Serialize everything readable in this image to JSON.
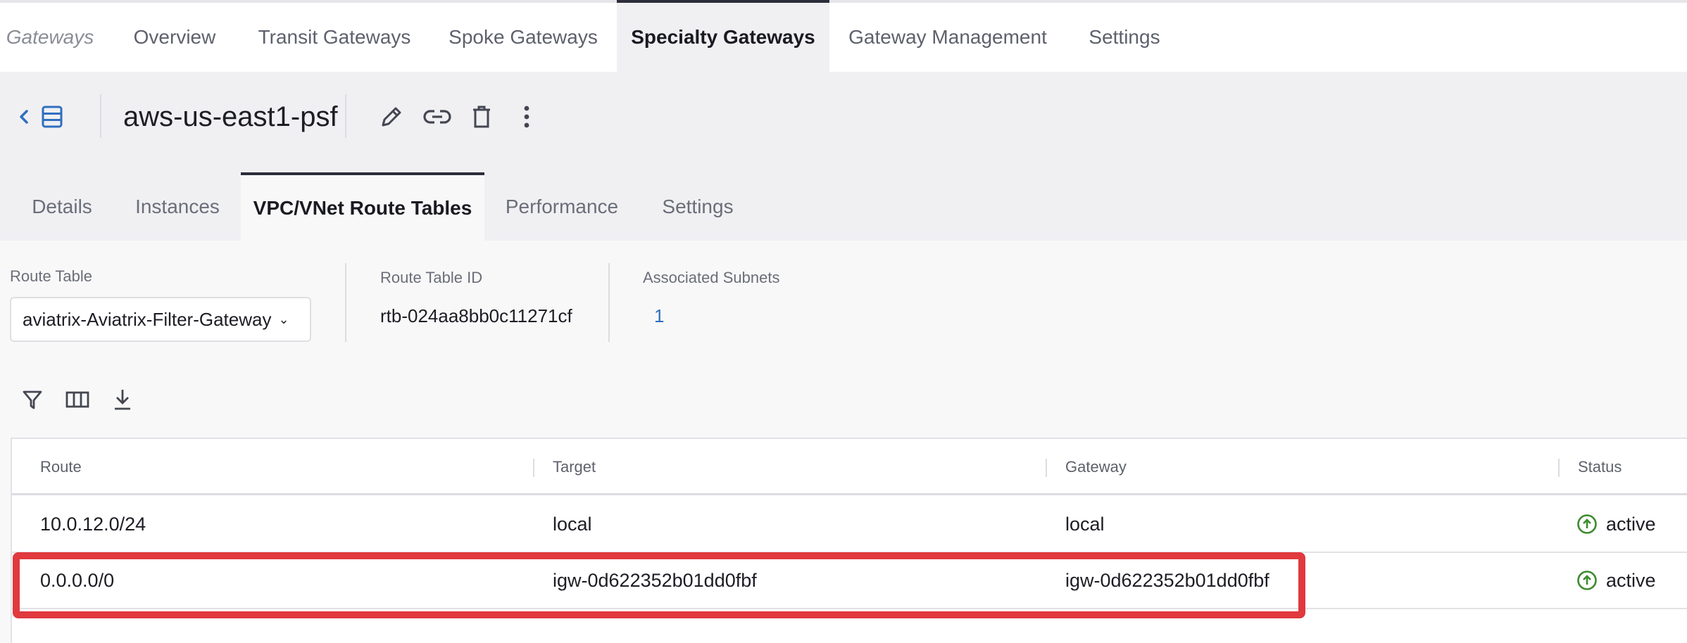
{
  "topnav": {
    "breadcrumb": "Gateways",
    "tabs": [
      "Overview",
      "Transit Gateways",
      "Spoke Gateways",
      "Specialty Gateways",
      "Gateway Management",
      "Settings"
    ],
    "active_tab": "Specialty Gateways"
  },
  "header": {
    "gateway_name": "aws-us-east1-psf",
    "icons": [
      "back-icon",
      "list-icon",
      "edit-icon",
      "link-icon",
      "delete-icon",
      "more-icon"
    ]
  },
  "subtabs": {
    "items": [
      "Details",
      "Instances",
      "VPC/VNet Route Tables",
      "Performance",
      "Settings"
    ],
    "active": "VPC/VNet Route Tables"
  },
  "route_table": {
    "label": "Route Table",
    "selected": "aviatrix-Aviatrix-Filter-Gateway",
    "id_label": "Route Table ID",
    "id_value": "rtb-024aa8bb0c11271cf",
    "subnets_label": "Associated Subnets",
    "subnets_value": "1"
  },
  "toolbar": {
    "icons": [
      "filter-icon",
      "columns-icon",
      "download-icon"
    ]
  },
  "table": {
    "columns": [
      "Route",
      "Target",
      "Gateway",
      "Status"
    ],
    "rows": [
      {
        "route": "10.0.12.0/24",
        "target": "local",
        "gateway": "local",
        "status": "active"
      },
      {
        "route": "0.0.0.0/0",
        "target": "igw-0d622352b01dd0fbf",
        "gateway": "igw-0d622352b01dd0fbf",
        "status": "active"
      }
    ]
  },
  "colors": {
    "accent": "#2f6fbf",
    "highlight": "#e0393e",
    "status_ok": "#3d8b2f"
  }
}
